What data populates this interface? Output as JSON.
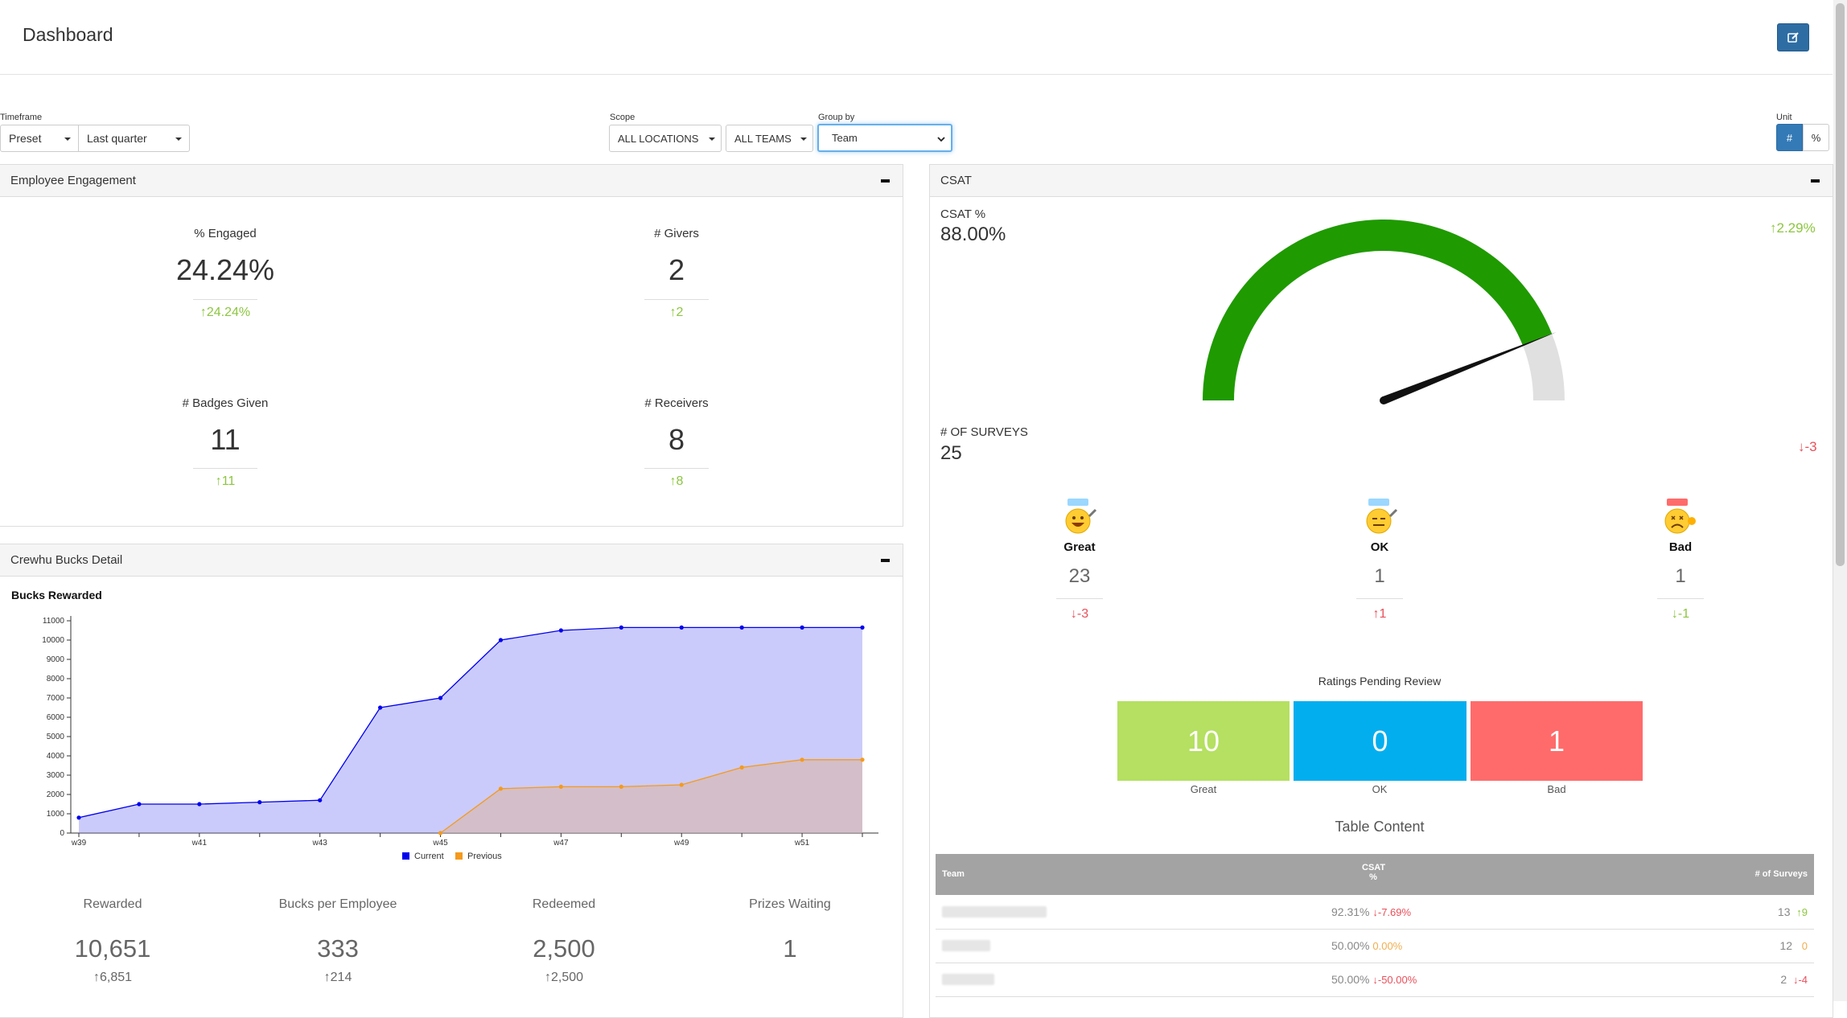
{
  "header": {
    "title": "Dashboard",
    "edit_icon": "edit-icon"
  },
  "filters": {
    "timeframe": {
      "label": "Timeframe",
      "preset": "Preset",
      "period": "Last quarter"
    },
    "scope": {
      "label": "Scope",
      "locations": "ALL LOCATIONS",
      "teams": "ALL TEAMS"
    },
    "group_by": {
      "label": "Group by",
      "value": "Team"
    },
    "unit": {
      "label": "Unit",
      "options": [
        "#",
        "%"
      ],
      "selected": "#"
    }
  },
  "engagement": {
    "title": "Employee Engagement",
    "stats": [
      {
        "label": "% Engaged",
        "value": "24.24%",
        "delta": "24.24%"
      },
      {
        "label": "# Givers",
        "value": "2",
        "delta": "2"
      },
      {
        "label": "# Badges Given",
        "value": "11",
        "delta": "11"
      },
      {
        "label": "# Receivers",
        "value": "8",
        "delta": "8"
      }
    ]
  },
  "bucks": {
    "title": "Crewhu Bucks Detail",
    "chart_title": "Bucks Rewarded",
    "legend": [
      "Current",
      "Previous"
    ],
    "summary": [
      {
        "label": "Rewarded",
        "value": "10,651",
        "delta": "6,851"
      },
      {
        "label": "Bucks per Employee",
        "value": "333",
        "delta": "214"
      },
      {
        "label": "Redeemed",
        "value": "2,500",
        "delta": "2,500"
      },
      {
        "label": "Prizes Waiting",
        "value": "1",
        "delta": ""
      }
    ]
  },
  "chart_data": {
    "type": "area",
    "title": "Bucks Rewarded",
    "xlabel": "",
    "ylabel": "",
    "x": [
      "w39",
      "w40",
      "w41",
      "w42",
      "w43",
      "w44",
      "w45",
      "w46",
      "w47",
      "w48",
      "w49",
      "w50",
      "w51",
      "w52"
    ],
    "x_tick_labels": [
      "w39",
      "w41",
      "w43",
      "w45",
      "w47",
      "w49",
      "w51"
    ],
    "ylim": [
      0,
      11000
    ],
    "y_ticks": [
      0,
      1000,
      2000,
      3000,
      4000,
      5000,
      6000,
      7000,
      8000,
      9000,
      10000,
      11000
    ],
    "series": [
      {
        "name": "Current",
        "color": "#0000ee",
        "values": [
          800,
          1500,
          1500,
          1600,
          1700,
          6500,
          7000,
          10000,
          10500,
          10650,
          10650,
          10650,
          10650,
          10650
        ]
      },
      {
        "name": "Previous",
        "color": "#f59a1b",
        "values": [
          null,
          null,
          null,
          null,
          null,
          null,
          0,
          2300,
          2400,
          2400,
          2500,
          3400,
          3800,
          3800
        ]
      }
    ],
    "legend_position": "bottom"
  },
  "csat": {
    "title": "CSAT",
    "pct_label": "CSAT %",
    "pct_value": "88.00%",
    "pct_delta": "2.29%",
    "gauge_fraction": 0.88,
    "surveys_label": "# OF SURVEYS",
    "surveys_value": "25",
    "surveys_delta": "-3",
    "faces": [
      {
        "label": "Great",
        "count": "23",
        "delta": "-3",
        "dir": "down",
        "icon": "great-face-icon"
      },
      {
        "label": "OK",
        "count": "1",
        "delta": "1",
        "dir": "up",
        "icon": "ok-face-icon"
      },
      {
        "label": "Bad",
        "count": "1",
        "delta": "-1",
        "dir": "up",
        "icon": "bad-face-icon"
      }
    ],
    "pending_title": "Ratings Pending Review",
    "pending": [
      {
        "label": "Great",
        "value": "10",
        "color": "#b5e061"
      },
      {
        "label": "OK",
        "value": "0",
        "color": "#03aeef"
      },
      {
        "label": "Bad",
        "value": "1",
        "color": "#ff6b6b"
      }
    ],
    "table_title": "Table Content",
    "table": {
      "headers": {
        "team": "Team",
        "csat_top": "CSAT",
        "csat_bottom": "%",
        "surveys": "# of Surveys"
      },
      "rows": [
        {
          "csat": "92.31%",
          "csat_delta": "-7.69%",
          "csat_dir": "down",
          "surveys": "13",
          "surveys_delta": "9",
          "surveys_dir": "up"
        },
        {
          "csat": "50.00%",
          "csat_delta": "0.00%",
          "csat_dir": "neutral",
          "surveys": "12",
          "surveys_delta": "0",
          "surveys_dir": "neutral"
        },
        {
          "csat": "50.00%",
          "csat_delta": "-50.00%",
          "csat_dir": "down",
          "surveys": "2",
          "surveys_delta": "-4",
          "surveys_dir": "down"
        }
      ]
    }
  },
  "colors": {
    "primary": "#337ab7",
    "up": "#8cc63f",
    "down": "#e8505b",
    "gauge": "#1f9a00"
  }
}
